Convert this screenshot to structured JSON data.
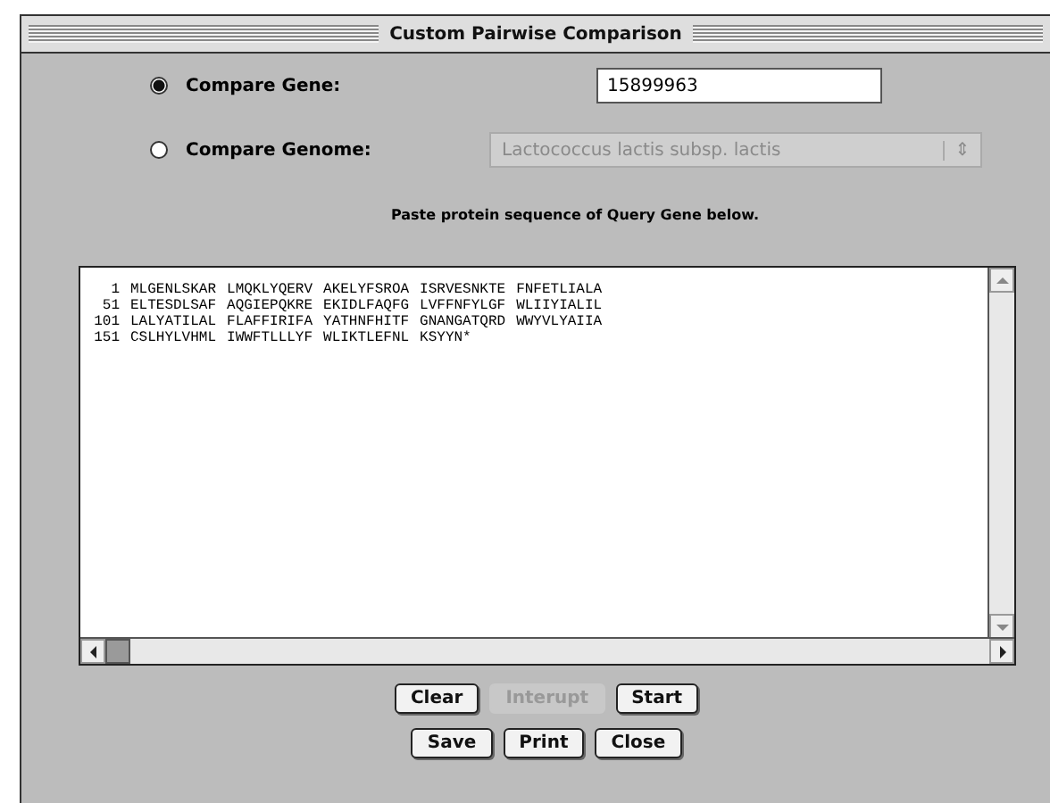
{
  "window": {
    "title": "Custom Pairwise Comparison"
  },
  "options": [
    {
      "label": "Compare Gene:",
      "selected": true,
      "kind": "field",
      "value": "15899963",
      "disabled": false
    },
    {
      "label": "Compare Genome:",
      "selected": false,
      "kind": "dropdown",
      "value": "Lactococcus lactis subsp. lactis",
      "disabled": true,
      "arrow": "⇕"
    }
  ],
  "instruction": "Paste protein sequence of Query Gene below.",
  "sequence_lines": [
    {
      "number": "1",
      "blocks": [
        "MLGENLSKAR",
        "LMQKLYQERV",
        "AKELYFSROA",
        "ISRVESNKTE",
        "FNFETLIALA"
      ]
    },
    {
      "number": "51",
      "blocks": [
        "ELTESDLSAF",
        "AQGIEPQKRE",
        "EKIDLFAQFG",
        "LVFFNFYLGF",
        "WLIIYIALIL"
      ]
    },
    {
      "number": "101",
      "blocks": [
        "LALYATILAL",
        "FLAFFIRIFA",
        "YATHNFHITF",
        "GNANGATQRD",
        "WWYVLYAIIA"
      ]
    },
    {
      "number": "151",
      "blocks": [
        "CSLHYLVHML",
        "IWWFTLLLYF",
        "WLIKTLEFNL",
        "KSYYN*"
      ]
    }
  ],
  "button_rows": [
    [
      {
        "label": "Clear",
        "disabled": false
      },
      {
        "label": "Interupt",
        "disabled": true
      },
      {
        "label": "Start",
        "disabled": false
      }
    ],
    [
      {
        "label": "Save",
        "disabled": false
      },
      {
        "label": "Print",
        "disabled": false
      },
      {
        "label": "Close",
        "disabled": false
      }
    ]
  ]
}
